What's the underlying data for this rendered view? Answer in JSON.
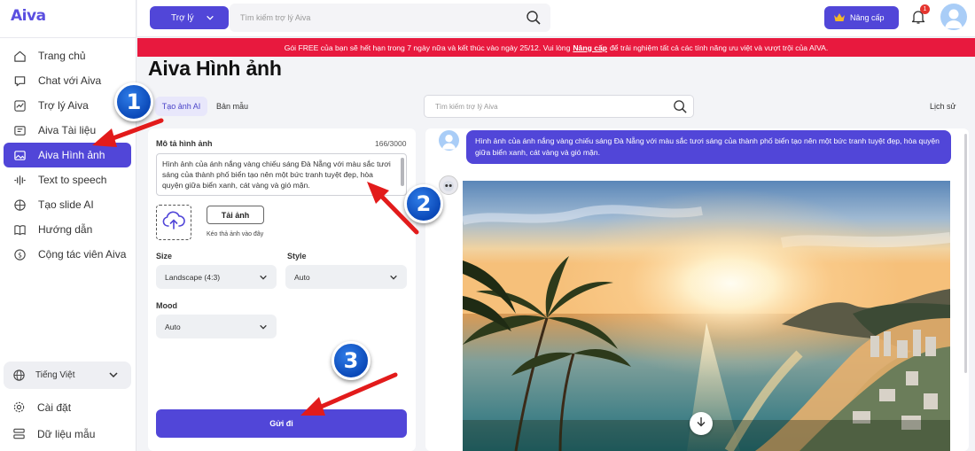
{
  "app": {
    "logo": "Aiva"
  },
  "sidebar": {
    "items": [
      {
        "label": "Trang chủ",
        "icon": "home-icon"
      },
      {
        "label": "Chat với Aiva",
        "icon": "chat-icon"
      },
      {
        "label": "Trợ lý Aiva",
        "icon": "chart-icon"
      },
      {
        "label": "Aiva Tài liệu",
        "icon": "document-icon"
      },
      {
        "label": "Aiva Hình ảnh",
        "icon": "image-icon",
        "active": true
      },
      {
        "label": "Text to speech",
        "icon": "sound-wave-icon"
      },
      {
        "label": "Tạo slide AI",
        "icon": "slides-icon"
      },
      {
        "label": "Hướng dẫn",
        "icon": "book-icon"
      },
      {
        "label": "Cộng tác viên Aiva",
        "icon": "dollar-icon"
      }
    ],
    "language": "Tiếng Việt",
    "settings": "Cài đặt",
    "sample_data": "Dữ liệu mẫu"
  },
  "header": {
    "assistant_button": "Trợ lý",
    "search_placeholder": "Tìm kiếm trợ lý Aiva",
    "upgrade_button": "Nâng cấp",
    "notification_count": "1"
  },
  "banner": {
    "text_before": "Gói FREE của bạn sẽ hết hạn trong 7 ngày nữa và kết thúc vào ngày 25/12. Vui lòng",
    "link": "Nâng cấp",
    "text_after": "để trải nghiệm tất cả các tính năng ưu việt và vượt trội của AIVA."
  },
  "page": {
    "title": "Aiva Hình ảnh",
    "tab_create": "Tạo ảnh AI",
    "tab_template": "Bản mẫu",
    "search_placeholder": "Tìm kiếm trợ lý Aiva",
    "history": "Lịch sử"
  },
  "form": {
    "description_label": "Mô tả hình ảnh",
    "counter": "166/3000",
    "prompt": "Hình ảnh của ánh nắng vàng chiếu sáng Đà Nẵng với màu sắc tươi sáng của thành phố biển tạo nên một bức tranh tuyệt đẹp, hòa quyện giữa biển xanh, cát vàng và gió mặn.",
    "upload_button": "Tải ảnh",
    "drag_hint": "Kéo thả ảnh vào đây",
    "size_label": "Size",
    "size_value": "Landscape (4:3)",
    "style_label": "Style",
    "style_value": "Auto",
    "mood_label": "Mood",
    "mood_value": "Auto",
    "send_button": "Gửi đi"
  },
  "chat": {
    "user_message": "Hình ảnh của ánh nắng vàng chiếu sáng Đà Nẵng với màu sắc tươi sáng của thành phố biển tạo nên một bức tranh tuyệt đẹp, hòa quyện giữa biển xanh, cát vàng và gió mặn."
  },
  "annotations": {
    "step1": "1",
    "step2": "2",
    "step3": "3"
  },
  "colors": {
    "accent": "#5146d8",
    "banner": "#e8193e",
    "arrow": "#e21b1b"
  }
}
